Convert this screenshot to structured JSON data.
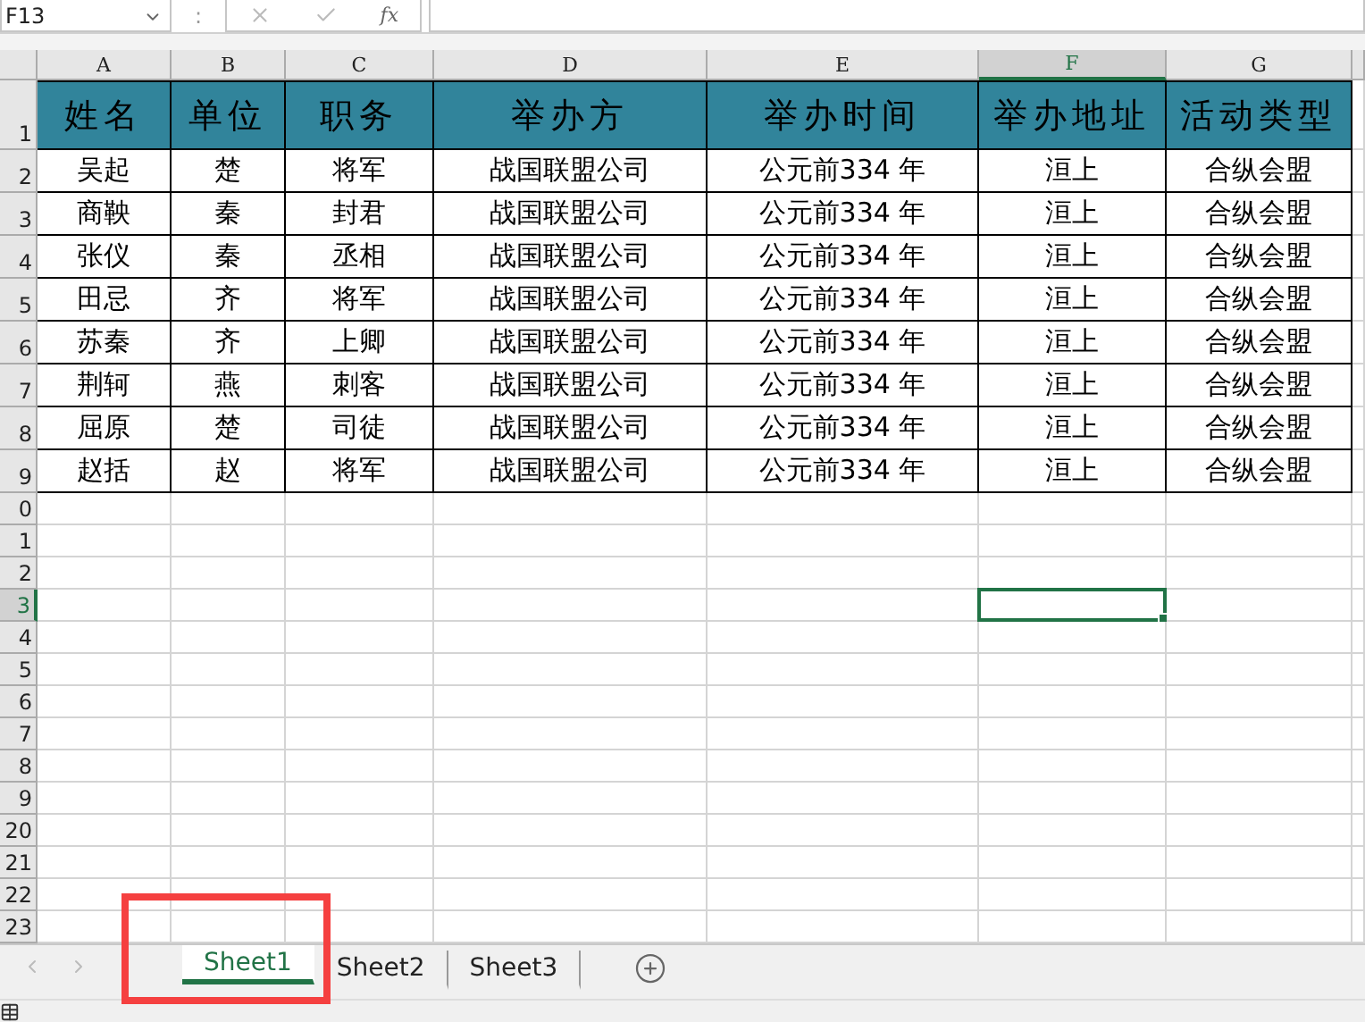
{
  "formula_bar": {
    "name_box": "F13",
    "separator": ":",
    "function_label": "fx"
  },
  "column_headers": [
    {
      "label": "A",
      "selected": false
    },
    {
      "label": "B",
      "selected": false
    },
    {
      "label": "C",
      "selected": false
    },
    {
      "label": "D",
      "selected": false
    },
    {
      "label": "E",
      "selected": false
    },
    {
      "label": "F",
      "selected": true
    },
    {
      "label": "G",
      "selected": false
    }
  ],
  "row_headers": [
    {
      "label": "1",
      "selected": false
    },
    {
      "label": "2",
      "selected": false
    },
    {
      "label": "3",
      "selected": false
    },
    {
      "label": "4",
      "selected": false
    },
    {
      "label": "5",
      "selected": false
    },
    {
      "label": "6",
      "selected": false
    },
    {
      "label": "7",
      "selected": false
    },
    {
      "label": "8",
      "selected": false
    },
    {
      "label": "9",
      "selected": false
    },
    {
      "label": "0",
      "selected": false
    },
    {
      "label": "1",
      "selected": false
    },
    {
      "label": "2",
      "selected": false
    },
    {
      "label": "3",
      "selected": true
    },
    {
      "label": "4",
      "selected": false
    },
    {
      "label": "5",
      "selected": false
    },
    {
      "label": "6",
      "selected": false
    },
    {
      "label": "7",
      "selected": false
    },
    {
      "label": "8",
      "selected": false
    },
    {
      "label": "9",
      "selected": false
    },
    {
      "label": "20",
      "selected": false
    },
    {
      "label": "21",
      "selected": false
    },
    {
      "label": "22",
      "selected": false
    },
    {
      "label": "23",
      "selected": false
    }
  ],
  "table": {
    "columns": [
      "姓名",
      "单位",
      "职务",
      "举办方",
      "举办时间",
      "举办地址",
      "活动类型"
    ],
    "rows": [
      [
        "吴起",
        "楚",
        "将军",
        "战国联盟公司",
        "公元前334 年",
        "洹上",
        "合纵会盟"
      ],
      [
        "商鞅",
        "秦",
        "封君",
        "战国联盟公司",
        "公元前334 年",
        "洹上",
        "合纵会盟"
      ],
      [
        "张仪",
        "秦",
        "丞相",
        "战国联盟公司",
        "公元前334 年",
        "洹上",
        "合纵会盟"
      ],
      [
        "田忌",
        "齐",
        "将军",
        "战国联盟公司",
        "公元前334 年",
        "洹上",
        "合纵会盟"
      ],
      [
        "苏秦",
        "齐",
        "上卿",
        "战国联盟公司",
        "公元前334 年",
        "洹上",
        "合纵会盟"
      ],
      [
        "荆轲",
        "燕",
        "刺客",
        "战国联盟公司",
        "公元前334 年",
        "洹上",
        "合纵会盟"
      ],
      [
        "屈原",
        "楚",
        "司徒",
        "战国联盟公司",
        "公元前334 年",
        "洹上",
        "合纵会盟"
      ],
      [
        "赵括",
        "赵",
        "将军",
        "战国联盟公司",
        "公元前334 年",
        "洹上",
        "合纵会盟"
      ]
    ]
  },
  "sheet_tabs": [
    {
      "label": "Sheet1",
      "selected": true,
      "highlighted": true
    },
    {
      "label": "Sheet2",
      "selected": false,
      "highlighted": false
    },
    {
      "label": "Sheet3",
      "selected": false,
      "highlighted": false
    }
  ]
}
